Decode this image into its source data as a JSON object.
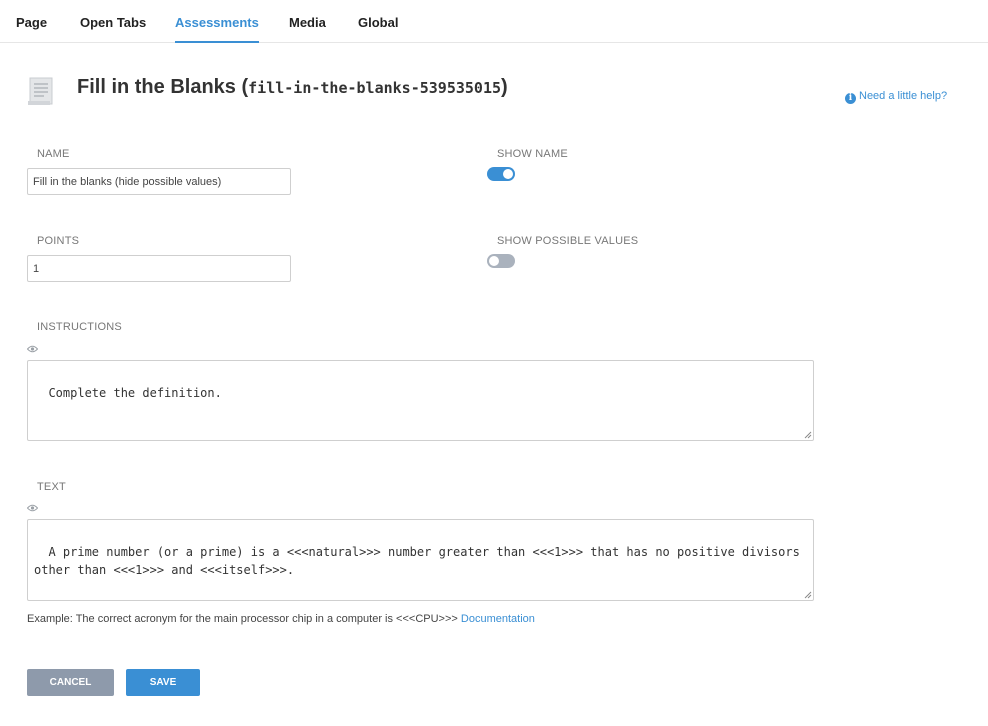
{
  "tabs": [
    {
      "label": "Page",
      "active": false
    },
    {
      "label": "Open Tabs",
      "active": false
    },
    {
      "label": "Assessments",
      "active": true
    },
    {
      "label": "Media",
      "active": false
    },
    {
      "label": "Global",
      "active": false
    }
  ],
  "header": {
    "title": "Fill in the Blanks",
    "open_paren": "(",
    "slug": "fill-in-the-blanks-539535015",
    "close_paren": ")",
    "help_link": "Need a little help?"
  },
  "form": {
    "name": {
      "label": "NAME",
      "value": "Fill in the blanks (hide possible values)"
    },
    "show_name": {
      "label": "SHOW NAME",
      "checked": true
    },
    "points": {
      "label": "POINTS",
      "value": "1"
    },
    "show_possible_values": {
      "label": "SHOW POSSIBLE VALUES",
      "checked": false
    },
    "instructions": {
      "label": "INSTRUCTIONS",
      "value": "Complete the definition."
    },
    "text": {
      "label": "TEXT",
      "value": "A prime number (or a prime) is a <<<natural>>> number greater than <<<1>>> that has no positive divisors other than <<<1>>> and <<<itself>>>."
    },
    "example": "Example: The correct acronym for the main processor chip in a computer is <<<CPU>>> ",
    "documentation_link": "Documentation"
  },
  "buttons": {
    "cancel": "CANCEL",
    "save": "SAVE"
  },
  "colors": {
    "accent": "#3a8fd4",
    "cancel_button": "#8e9aab",
    "toggle_off": "#aab2bd"
  }
}
